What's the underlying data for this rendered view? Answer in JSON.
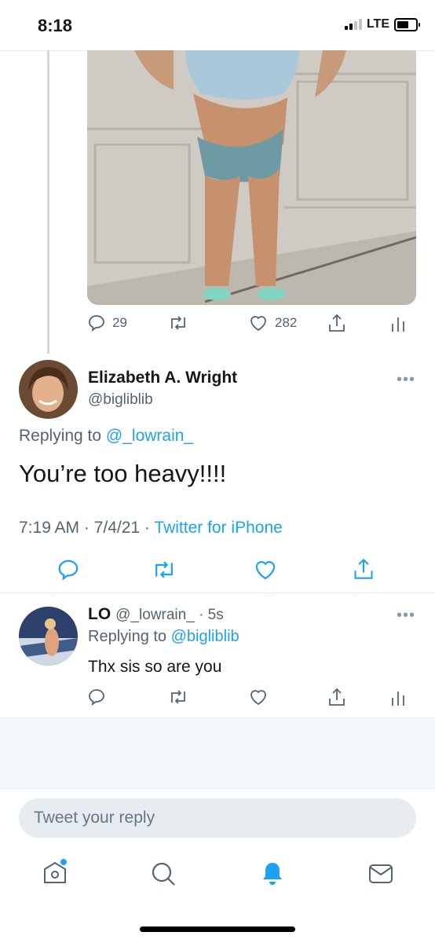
{
  "status_bar": {
    "time": "8:18",
    "network": "LTE"
  },
  "original_tweet": {
    "replies": "29",
    "retweets": "",
    "likes": "282"
  },
  "focused_tweet": {
    "name": "Elizabeth A. Wright",
    "handle": "@bigliblib",
    "replying_prefix": "Replying to",
    "replying_to": "@_lowrain_",
    "text": "You’re too heavy!!!!",
    "time_date": "7:19 AM · 7/4/21 ·",
    "source": "Twitter for iPhone"
  },
  "reply_tweet": {
    "name": "LO",
    "handle_time": "@_lowrain_ · 5s",
    "replying_prefix": "Replying to",
    "replying_to": "@bigliblib",
    "text": "Thx sis so are you"
  },
  "composer": {
    "placeholder": "Tweet your reply"
  },
  "more_glyph": "•••",
  "colors": {
    "accent": "#1da1f2",
    "secondary_text": "#536471",
    "divider": "#e6ecf0"
  },
  "icons": [
    "reply-icon",
    "retweet-icon",
    "like-icon",
    "share-icon",
    "analytics-icon",
    "home-icon",
    "search-icon",
    "notifications-icon",
    "messages-icon"
  ]
}
